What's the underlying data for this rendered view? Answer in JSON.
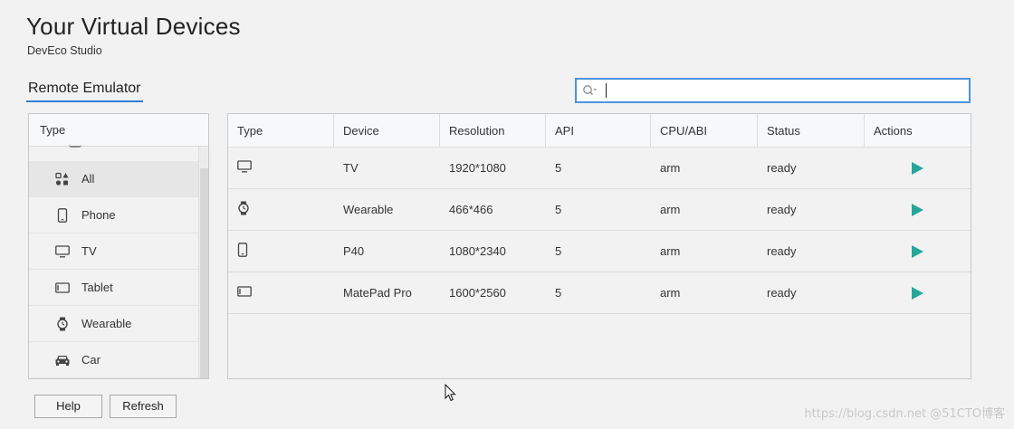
{
  "header": {
    "title": "Your Virtual Devices",
    "subtitle": "DevEco Studio"
  },
  "tabs": {
    "active_label": "Remote Emulator"
  },
  "search": {
    "value": "",
    "placeholder": ""
  },
  "categories": {
    "header": "Type",
    "items": [
      {
        "label": "All",
        "icon": "grid-icon",
        "selected": true
      },
      {
        "label": "Phone",
        "icon": "phone-icon",
        "selected": false
      },
      {
        "label": "TV",
        "icon": "tv-icon",
        "selected": false
      },
      {
        "label": "Tablet",
        "icon": "tablet-icon",
        "selected": false
      },
      {
        "label": "Wearable",
        "icon": "watch-icon",
        "selected": false
      },
      {
        "label": "Car",
        "icon": "car-icon",
        "selected": false
      }
    ]
  },
  "table": {
    "columns": [
      "Type",
      "Device",
      "Resolution",
      "API",
      "CPU/ABI",
      "Status",
      "Actions"
    ],
    "rows": [
      {
        "type_icon": "tv-icon",
        "device": "TV",
        "resolution": "1920*1080",
        "api": "5",
        "cpu": "arm",
        "status": "ready"
      },
      {
        "type_icon": "watch-icon",
        "device": "Wearable",
        "resolution": "466*466",
        "api": "5",
        "cpu": "arm",
        "status": "ready"
      },
      {
        "type_icon": "phone-icon",
        "device": "P40",
        "resolution": "1080*2340",
        "api": "5",
        "cpu": "arm",
        "status": "ready"
      },
      {
        "type_icon": "tablet-icon",
        "device": "MatePad Pro",
        "resolution": "1600*2560",
        "api": "5",
        "cpu": "arm",
        "status": "ready"
      }
    ]
  },
  "buttons": {
    "help": "Help",
    "refresh": "Refresh"
  },
  "watermark": "https://blog.csdn.net @51CTO博客",
  "colors": {
    "accent": "#2f7fd6",
    "play": "#26a69a",
    "search_border": "#4d94db"
  }
}
